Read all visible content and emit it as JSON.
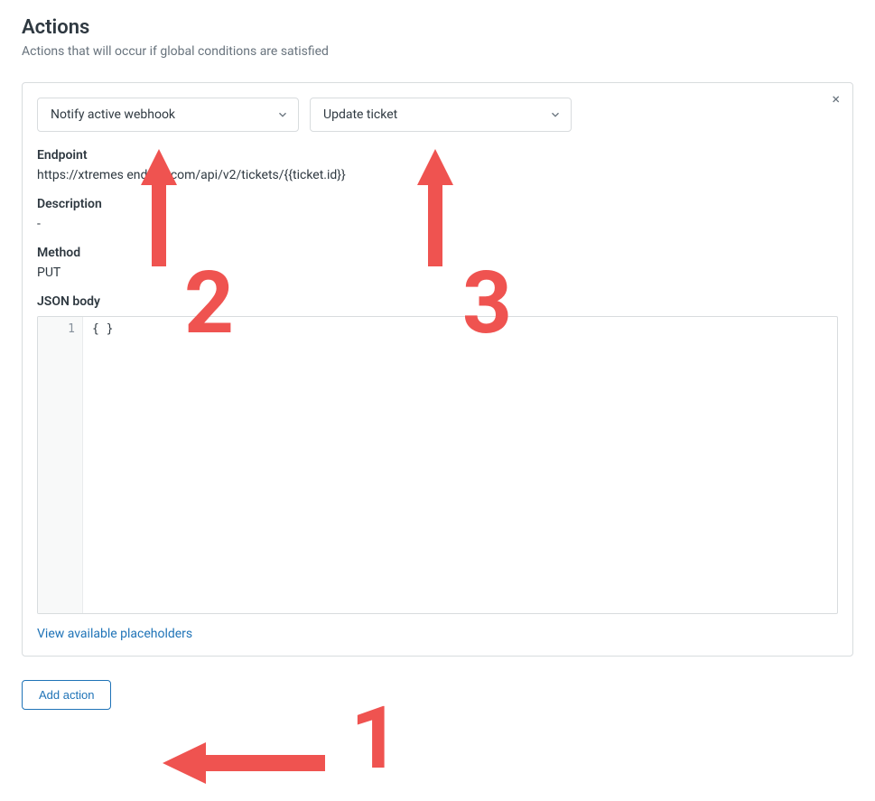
{
  "header": {
    "title": "Actions",
    "subtitle": "Actions that will occur if global conditions are satisfied"
  },
  "action_card": {
    "select_action_type": "Notify active webhook",
    "select_webhook_target": "Update ticket",
    "endpoint_label": "Endpoint",
    "endpoint_value": "https://xtremes         endesk.com/api/v2/tickets/{{ticket.id}}",
    "description_label": "Description",
    "description_value": "-",
    "method_label": "Method",
    "method_value": "PUT",
    "json_body_label": "JSON body",
    "json_body_line1_number": "1",
    "json_body_line1_content": "{ }",
    "placeholders_link": "View available placeholders"
  },
  "buttons": {
    "add_action": "Add action"
  },
  "annotations": {
    "n1": "1",
    "n2": "2",
    "n3": "3"
  },
  "icons": {
    "close": "×"
  }
}
